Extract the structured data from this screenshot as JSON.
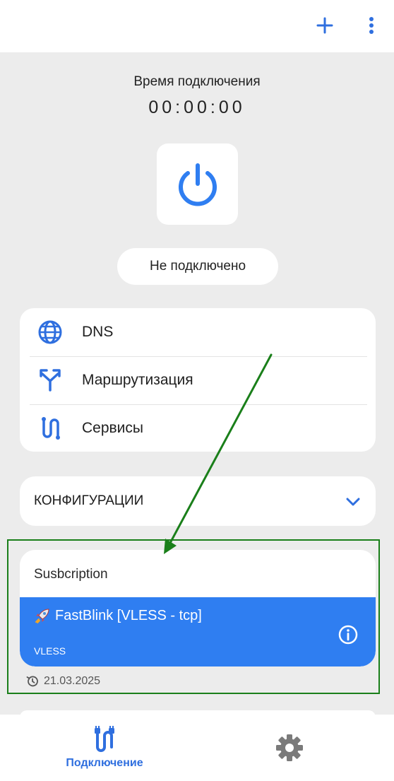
{
  "top_bar": {
    "add_icon": "plus-icon",
    "more_icon": "more-vertical-icon",
    "accent": "#2f6fdf"
  },
  "connection": {
    "time_label": "Время подключения",
    "time_value": "00:00:00",
    "status": "Не подключено",
    "power_icon": "power-icon"
  },
  "menu": {
    "items": [
      {
        "label": "DNS",
        "icon": "globe-icon"
      },
      {
        "label": "Маршрутизация",
        "icon": "route-split-icon"
      },
      {
        "label": "Сервисы",
        "icon": "services-icon"
      }
    ]
  },
  "configurations": {
    "title": "КОНФИГУРАЦИИ",
    "chevron": "chevron-down-icon"
  },
  "subscription": {
    "title": "Susbcription",
    "server_name": "FastBlink [VLESS - tcp]",
    "server_emoji": "🚀",
    "protocol": "VLESS",
    "updated": "21.03.2025",
    "row_color": "#2f7ef1"
  },
  "bottom_nav": {
    "items": [
      {
        "label": "Подключение",
        "icon": "connection-icon",
        "active": true
      },
      {
        "label": "",
        "icon": "gear-icon",
        "active": false
      }
    ]
  },
  "annotation": {
    "arrow_color": "#1a7f1a"
  }
}
